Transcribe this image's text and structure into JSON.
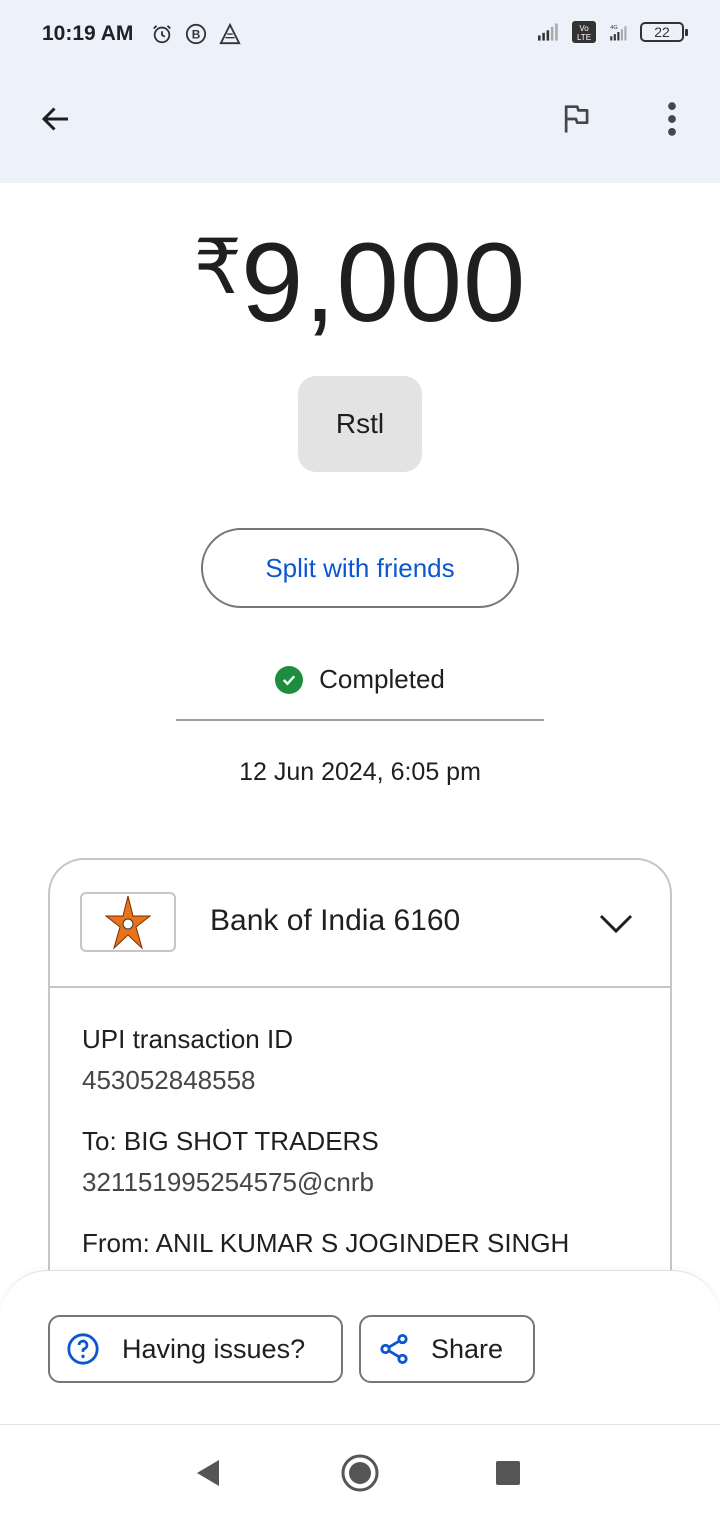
{
  "status_bar": {
    "time": "10:19 AM",
    "volte": "Vo LTE",
    "network_type": "4G",
    "battery": "22"
  },
  "app_bar": {
    "back_icon": "arrow-back-icon",
    "flag_icon": "flag-icon",
    "more_icon": "more-vert-icon"
  },
  "transaction": {
    "currency_symbol": "₹",
    "amount": "9,000",
    "note": "Rstl",
    "split_label": "Split with friends",
    "status": "Completed",
    "status_color": "#1e8e3e",
    "datetime": "12 Jun 2024, 6:05 pm"
  },
  "card": {
    "bank_name": "Bank of India 6160",
    "fields": [
      {
        "label": "UPI transaction ID",
        "value": "453052848558"
      },
      {
        "label": "To: BIG SHOT TRADERS",
        "value": "321151995254575@cnrb"
      },
      {
        "label": "From: ANIL KUMAR S JOGINDER SINGH",
        "value": ""
      }
    ]
  },
  "actions": {
    "issues_label": "Having issues?",
    "share_label": "Share"
  },
  "colors": {
    "accent": "#0b57d0",
    "app_bar_bg": "#edf2fa"
  }
}
